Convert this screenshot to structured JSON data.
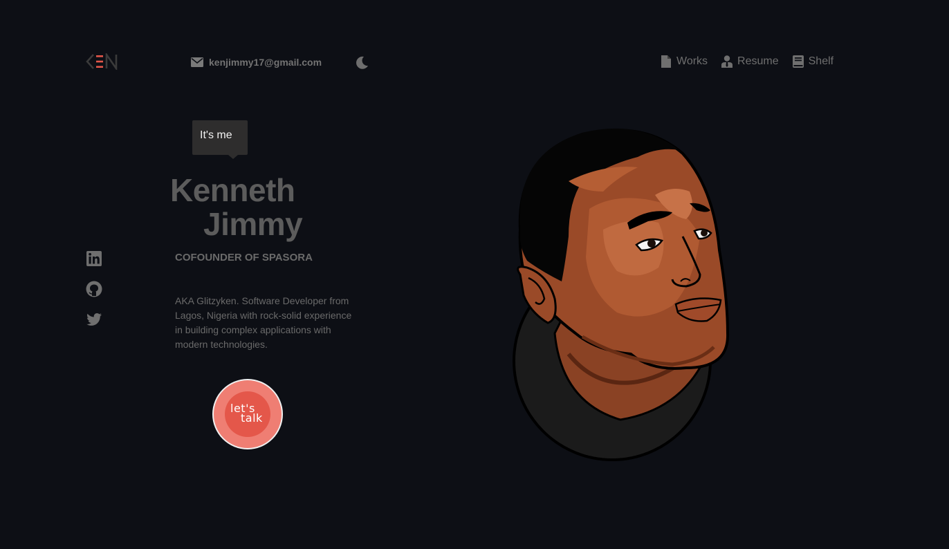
{
  "header": {
    "logo_text": "KEN",
    "email": "kenjimmy17@gmail.com",
    "theme_icon": "moon-icon"
  },
  "nav": {
    "items": [
      {
        "label": "Works",
        "icon": "file-icon"
      },
      {
        "label": "Resume",
        "icon": "user-tie-icon"
      },
      {
        "label": "Shelf",
        "icon": "book-icon"
      }
    ]
  },
  "hero": {
    "bubble": "It's me",
    "first_name": "Kenneth",
    "last_name": "Jimmy",
    "role": "COFOUNDER OF SPASORA",
    "bio": "AKA Glitzyken. Software Developer from Lagos, Nigeria with rock-solid experience in building complex applications with modern technologies.",
    "cta_line1": "let's",
    "cta_line2": "talk"
  },
  "social": [
    "linkedin-icon",
    "github-icon",
    "twitter-icon"
  ],
  "colors": {
    "background": "#0d0f15",
    "accent": "#e4574a",
    "accent_light": "#ef7e73",
    "text_muted": "#6a6a6a"
  }
}
